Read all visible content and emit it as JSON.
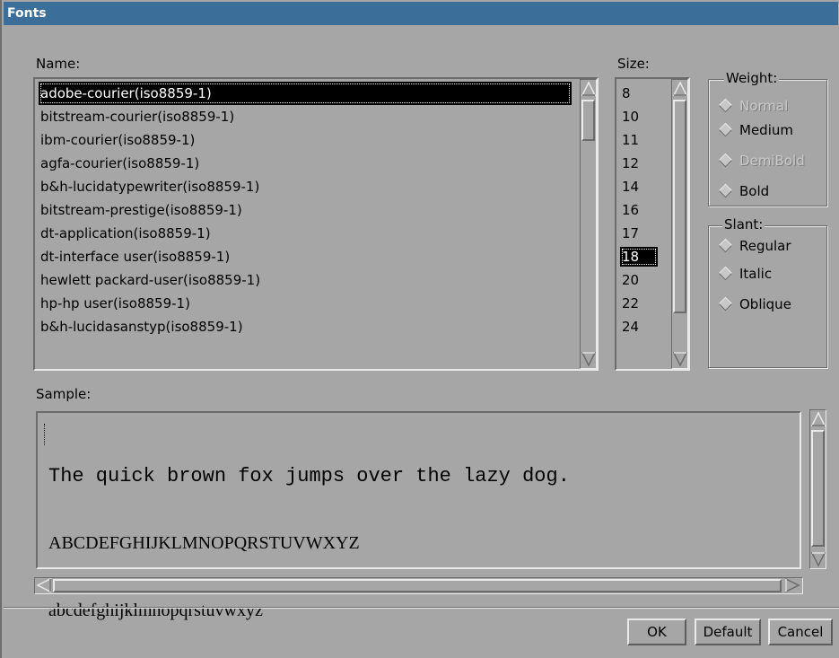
{
  "window": {
    "title": "Fonts"
  },
  "name_section": {
    "label": "Name:",
    "items": [
      "adobe-courier(iso8859-1)",
      "bitstream-courier(iso8859-1)",
      "ibm-courier(iso8859-1)",
      "agfa-courier(iso8859-1)",
      "b&h-lucidatypewriter(iso8859-1)",
      "bitstream-prestige(iso8859-1)",
      "dt-application(iso8859-1)",
      "dt-interface user(iso8859-1)",
      "hewlett packard-user(iso8859-1)",
      "hp-hp user(iso8859-1)",
      "b&h-lucidasanstyp(iso8859-1)"
    ],
    "selected": "adobe-courier(iso8859-1)"
  },
  "size_section": {
    "label": "Size:",
    "items": [
      "8",
      "10",
      "11",
      "12",
      "14",
      "16",
      "17",
      "18",
      "20",
      "22",
      "24"
    ],
    "selected": "18"
  },
  "weight": {
    "legend": "Weight:",
    "options": [
      {
        "label": "Normal",
        "enabled": false
      },
      {
        "label": "Medium",
        "enabled": true
      },
      {
        "label": "DemiBold",
        "enabled": false
      },
      {
        "label": "Bold",
        "enabled": true
      }
    ]
  },
  "slant": {
    "legend": "Slant:",
    "options": [
      "Regular",
      "Italic",
      "Oblique"
    ]
  },
  "sample": {
    "label": "Sample:",
    "line1": "The quick brown fox jumps over the lazy dog.",
    "line2": "ABCDEFGHIJKLMNOPQRSTUVWXYZ",
    "line3": "abcdefghijklmnopqrstuvwxyz"
  },
  "buttons": {
    "ok": "OK",
    "default": "Default",
    "cancel": "Cancel"
  }
}
